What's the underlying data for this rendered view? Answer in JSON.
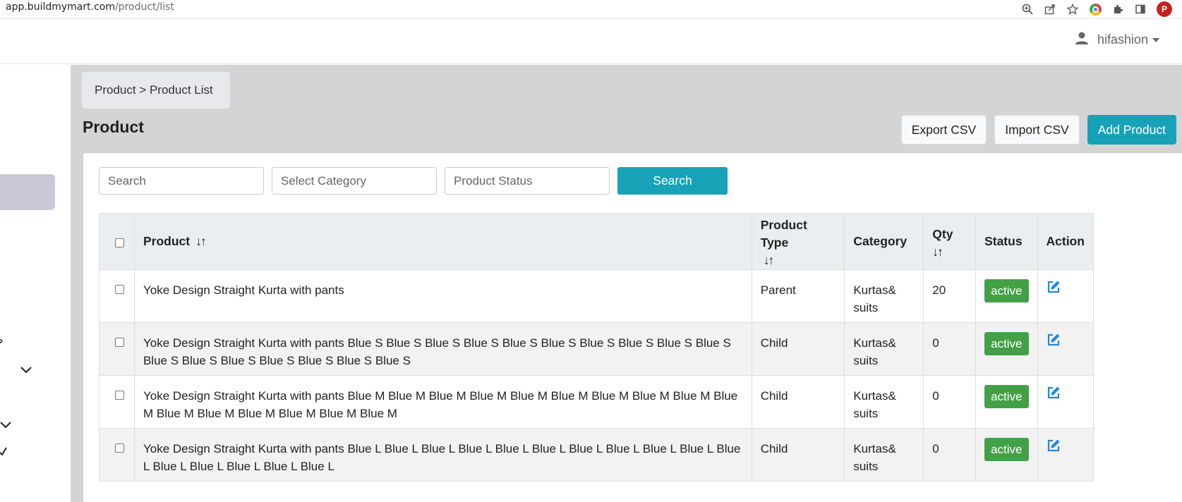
{
  "browser": {
    "url_host": "app.buildmymart.com",
    "url_path": "/product/list",
    "profile_initial": "P"
  },
  "header": {
    "username": "hifashion"
  },
  "breadcrumb": {
    "text": "Product > Product List"
  },
  "page": {
    "title": "Product",
    "export_label": "Export CSV",
    "import_label": "Import CSV",
    "add_label": "Add Product"
  },
  "filters": {
    "search_placeholder": "Search",
    "category_placeholder": "Select Category",
    "status_placeholder": "Product Status",
    "search_button": "Search"
  },
  "table": {
    "headers": {
      "product": "Product",
      "product_type": "Product Type",
      "category": "Category",
      "qty": "Qty",
      "status": "Status",
      "action": "Action"
    },
    "sort_glyph": "↓↑",
    "rows": [
      {
        "product": "Yoke Design Straight Kurta with pants",
        "type": "Parent",
        "category": "Kurtas& suits",
        "qty": "20",
        "status": "active"
      },
      {
        "product": "Yoke Design Straight Kurta with pants Blue S Blue S Blue S Blue S Blue S Blue S Blue S Blue S Blue S Blue S Blue S Blue S Blue S Blue S Blue S Blue S Blue S",
        "type": "Child",
        "category": "Kurtas& suits",
        "qty": "0",
        "status": "active"
      },
      {
        "product": "Yoke Design Straight Kurta with pants Blue M Blue M Blue M Blue M Blue M Blue M Blue M Blue M Blue M Blue M Blue M Blue M Blue M Blue M Blue M Blue M",
        "type": "Child",
        "category": "Kurtas& suits",
        "qty": "0",
        "status": "active"
      },
      {
        "product": "Yoke Design Straight Kurta with pants Blue L Blue L Blue L Blue L Blue L Blue L Blue L Blue L Blue L Blue L Blue L Blue L Blue L Blue L Blue L Blue L",
        "type": "Child",
        "category": "Kurtas& suits",
        "qty": "0",
        "status": "active"
      }
    ]
  },
  "colors": {
    "accent": "#17a2b8",
    "active_badge": "#43a047",
    "edit_icon": "#1e88e5"
  }
}
